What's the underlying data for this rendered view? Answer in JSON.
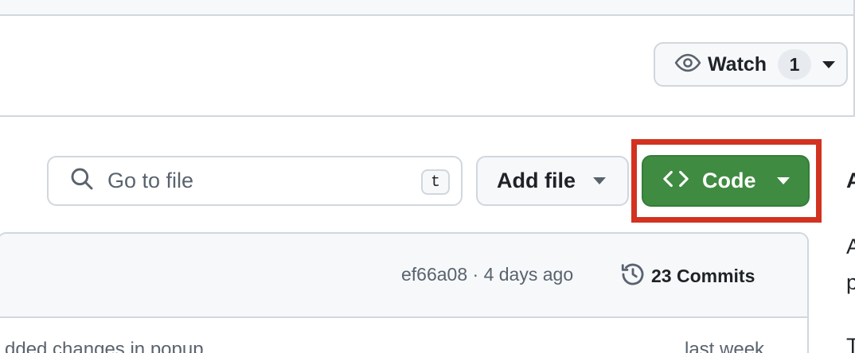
{
  "repo_header": {
    "watch": {
      "label": "Watch",
      "count": "1",
      "icon": "eye-icon"
    }
  },
  "toolbar": {
    "search": {
      "placeholder": "Go to file",
      "shortcut": "t",
      "icon": "search-icon"
    },
    "add_file": {
      "label": "Add file"
    },
    "code": {
      "label": "Code",
      "icon": "code-brackets-icon",
      "color": "#3f8b41"
    }
  },
  "latest_commit": {
    "hash": "ef66a08",
    "time": "4 days ago",
    "commits_label": "23 Commits",
    "meta_text": "ef66a08 · 4 days ago"
  },
  "files": [
    {
      "message": "dded changes in popup",
      "time": "last week"
    }
  ],
  "sidebar_fragments": [
    "A",
    "A",
    "p",
    "T"
  ],
  "colors": {
    "accent_green": "#3f8b41",
    "highlight_red": "#d2321f",
    "border": "#d0d7de"
  }
}
